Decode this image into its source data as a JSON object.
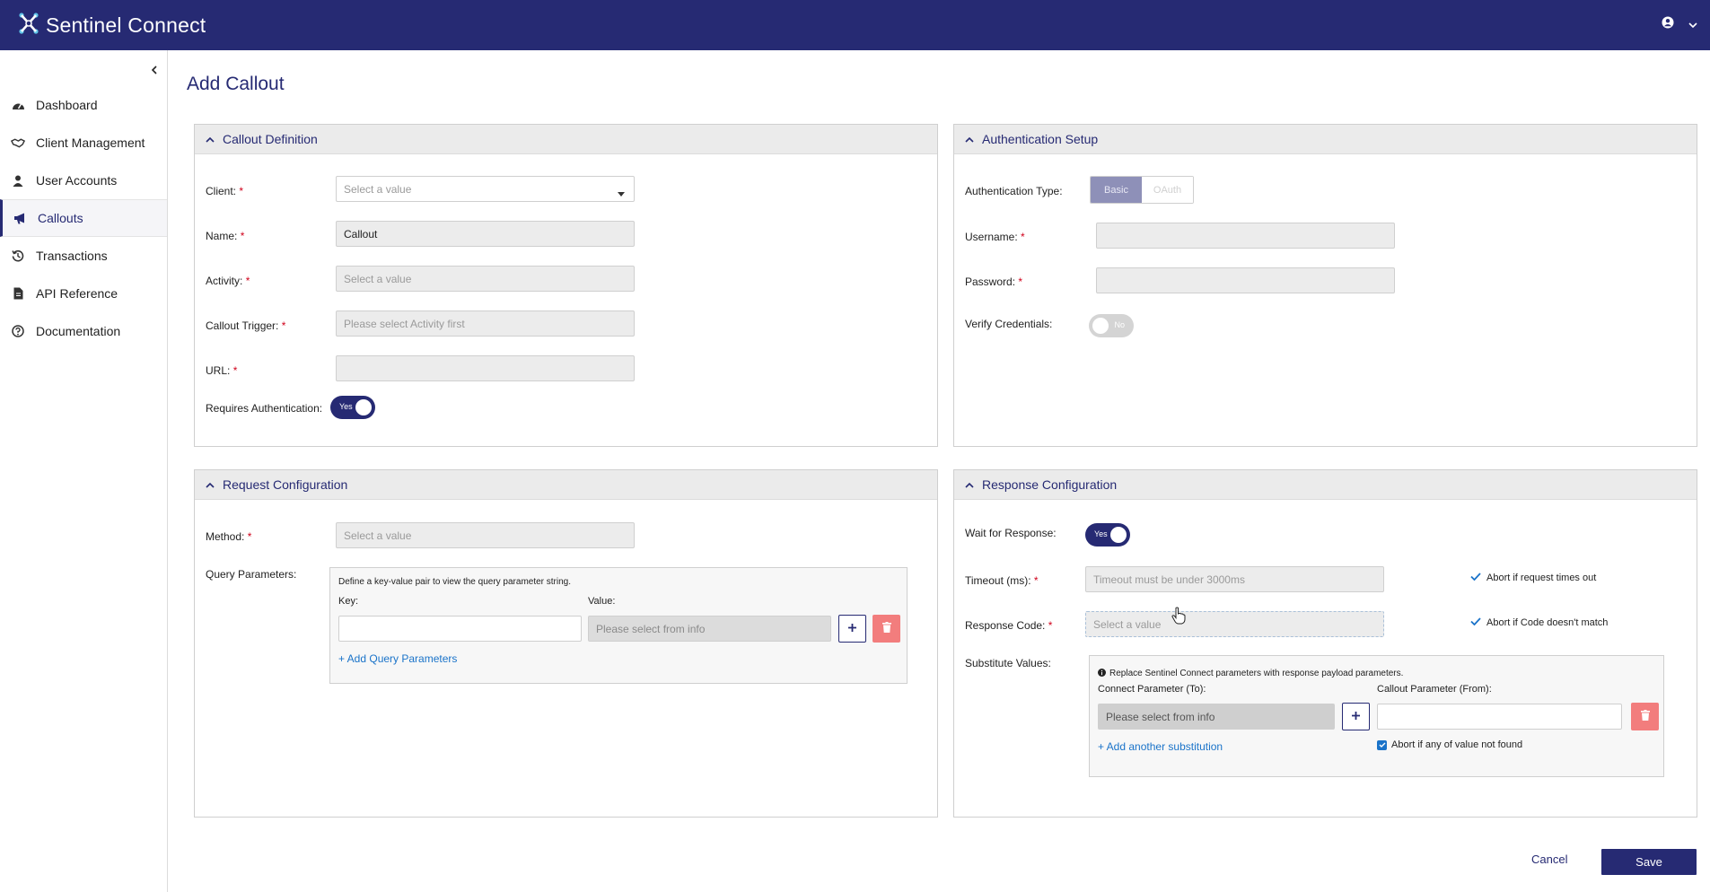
{
  "app": {
    "name": "Sentinel Connect"
  },
  "sidebar": {
    "items": [
      {
        "label": "Dashboard",
        "icon": "dashboard-icon"
      },
      {
        "label": "Client Management",
        "icon": "handshake-icon"
      },
      {
        "label": "User Accounts",
        "icon": "user-icon"
      },
      {
        "label": "Callouts",
        "icon": "megaphone-icon",
        "active": true
      },
      {
        "label": "Transactions",
        "icon": "history-icon"
      },
      {
        "label": "API Reference",
        "icon": "document-icon"
      },
      {
        "label": "Documentation",
        "icon": "question-circle-icon"
      }
    ]
  },
  "page": {
    "title": "Add Callout"
  },
  "callout_definition": {
    "header": "Callout Definition",
    "client_label": "Client:",
    "client_placeholder": "Select a value",
    "name_label": "Name:",
    "name_value": "Callout",
    "activity_label": "Activity:",
    "activity_placeholder": "Select a value",
    "trigger_label": "Callout Trigger:",
    "trigger_placeholder": "Please select Activity first",
    "url_label": "URL:",
    "url_value": "",
    "requires_auth_label": "Requires Authentication:",
    "requires_auth_toggle": "Yes",
    "required_mark": "*"
  },
  "authentication_setup": {
    "header": "Authentication Setup",
    "type_label": "Authentication Type:",
    "type_options": [
      "Basic",
      "OAuth"
    ],
    "type_selected": "Basic",
    "username_label": "Username:",
    "username_value": "",
    "password_label": "Password:",
    "password_value": "",
    "verify_label": "Verify Credentials:",
    "verify_toggle": "No"
  },
  "request_configuration": {
    "header": "Request Configuration",
    "method_label": "Method:",
    "method_placeholder": "Select a value",
    "query_label": "Query Parameters:",
    "query_hint": "Define a key-value pair to view the query parameter string.",
    "key_label": "Key:",
    "key_value": "",
    "value_label": "Value:",
    "value_placeholder": "Please select from info",
    "add_link": "+ Add Query Parameters"
  },
  "response_configuration": {
    "header": "Response Configuration",
    "wait_label": "Wait for Response:",
    "wait_toggle": "Yes",
    "timeout_label": "Timeout (ms):",
    "timeout_placeholder": "Timeout must be under 3000ms",
    "abort_timeout_label": "Abort if request times out",
    "code_label": "Response Code:",
    "code_placeholder": "Select a value",
    "abort_code_label": "Abort if Code doesn't match",
    "substitute_label": "Substitute Values:",
    "substitute_hint": "Replace Sentinel Connect parameters with response payload parameters.",
    "connect_param_label": "Connect Parameter (To):",
    "connect_param_placeholder": "Please select from info",
    "callout_param_label": "Callout Parameter (From):",
    "callout_param_value": "",
    "add_substitution_link": "+ Add another substitution",
    "abort_missing_label": "Abort if any of value not found"
  },
  "actions": {
    "cancel": "Cancel",
    "save": "Save"
  },
  "colors": {
    "brand": "#262a73",
    "link": "#1a73c9",
    "danger": "#f27d7d",
    "required": "#d0021b"
  }
}
